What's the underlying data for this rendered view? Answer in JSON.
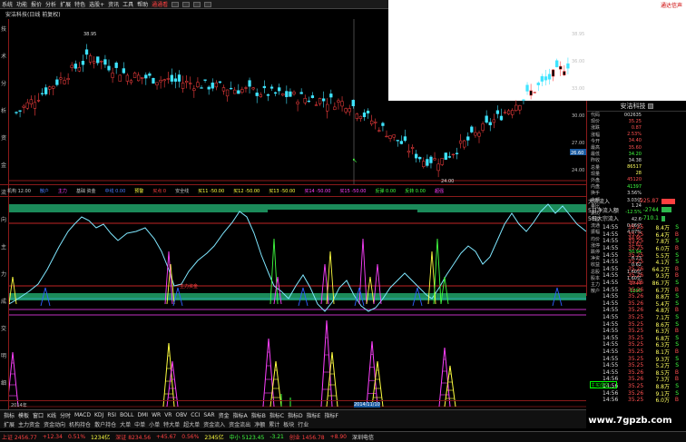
{
  "menu": {
    "items": [
      "系统",
      "功能",
      "报价",
      "分析",
      "扩展",
      "特色",
      "选股+",
      "资讯",
      "工具",
      "帮助"
    ],
    "highlight": "通通看",
    "notice": "通达信声"
  },
  "window_title": "安洁科技(日线 前复权)",
  "left_axis_labels": [
    "技",
    "术",
    "分",
    "析",
    "资",
    "金",
    "流",
    "向",
    "主",
    "力",
    "成",
    "交",
    "明",
    "细"
  ],
  "price_axis": {
    "labels": [
      "38.95",
      "36.00",
      "33.00",
      "30.00",
      "27.00",
      "24.00"
    ],
    "marks": {
      "high": "38.95",
      "low": "24.00",
      "current": "26.60"
    }
  },
  "indicator_bar": {
    "items": [
      {
        "text": "机构 12.00",
        "color": "#cccccc"
      },
      {
        "text": "散户",
        "color": "#4c7cff"
      },
      {
        "text": "主力",
        "color": "#ff40ff"
      },
      {
        "text": "基础 资金",
        "color": "#cccccc"
      },
      {
        "text": "中线 0.00",
        "color": "#4c7cff"
      },
      {
        "text": "预警",
        "color": "#ffff40"
      },
      {
        "text": "买点 0",
        "color": "#ff4040"
      },
      {
        "text": "安全线",
        "color": "#cccccc"
      },
      {
        "text": "买11 -50.00",
        "color": "#ffff40"
      },
      {
        "text": "买12 -50.00",
        "color": "#ffff40"
      },
      {
        "text": "买13 -50.00",
        "color": "#ffff40"
      },
      {
        "text": "买14 -50.00",
        "color": "#ff40ff"
      },
      {
        "text": "买15 -50.00",
        "color": "#ff40ff"
      },
      {
        "text": "反弹 0.00",
        "color": "#40ff40"
      },
      {
        "text": "反转 0.00",
        "color": "#40ff40"
      },
      {
        "text": "超强",
        "color": "#ff40ff"
      }
    ]
  },
  "osc_labels": {
    "mid": "主力资金"
  },
  "date_bar": {
    "labels": [
      "2014年",
      "2014/11/10"
    ]
  },
  "bottom_tabs": [
    "指标",
    "模板",
    "窗口",
    "K线",
    "分时",
    "MACD",
    "KDJ",
    "RSI",
    "BOLL",
    "DMI",
    "WR",
    "VR",
    "OBV",
    "CCI",
    "SAR",
    "资金",
    "指标A",
    "指标B",
    "指标C",
    "指标D",
    "指标E",
    "指标F"
  ],
  "second_tabs": [
    "扩展",
    "主力资金",
    "资金动向",
    "机构持仓",
    "散户持仓",
    "大单",
    "中单",
    "小单",
    "特大单",
    "超大单",
    "资金流入",
    "资金流出",
    "净额",
    "累计",
    "板块",
    "行业"
  ],
  "status_bar": {
    "items": [
      {
        "text": "上证 2456.77",
        "color": "#ff4040"
      },
      {
        "text": "+12.34",
        "color": "#ff4040"
      },
      {
        "text": "0.51%",
        "color": "#ff4040"
      },
      {
        "text": "1234亿",
        "color": "#ffff40"
      },
      {
        "text": "深证 8234.56",
        "color": "#ff4040"
      },
      {
        "text": "+45.67",
        "color": "#ff4040"
      },
      {
        "text": "0.56%",
        "color": "#ff4040"
      },
      {
        "text": "2345亿",
        "color": "#ffff40"
      },
      {
        "text": "中小 5123.45",
        "color": "#40ff40"
      },
      {
        "text": "-3.21",
        "color": "#40ff40"
      },
      {
        "text": "创业 1456.78",
        "color": "#ff4040"
      },
      {
        "text": "+8.90",
        "color": "#ff4040"
      },
      {
        "text": "深圳电信",
        "color": "#dddddd"
      }
    ]
  },
  "quote_panel": {
    "title": "安洁科技",
    "rows": [
      {
        "k": "代码",
        "v": "002635",
        "color": "#dddddd"
      },
      {
        "k": "现价",
        "v": "35.25",
        "color": "#ff5050"
      },
      {
        "k": "涨跌",
        "v": "0.87",
        "color": "#ff5050"
      },
      {
        "k": "涨幅",
        "v": "2.53%",
        "color": "#ff5050"
      },
      {
        "k": "今开",
        "v": "34.40",
        "color": "#ff5050"
      },
      {
        "k": "最高",
        "v": "35.60",
        "color": "#ff5050"
      },
      {
        "k": "最低",
        "v": "34.20",
        "color": "#40ff40"
      },
      {
        "k": "昨收",
        "v": "34.38",
        "color": "#dddddd"
      },
      {
        "k": "总量",
        "v": "86517",
        "color": "#ffff60"
      },
      {
        "k": "现量",
        "v": "28",
        "color": "#ffff60"
      },
      {
        "k": "外盘",
        "v": "45120",
        "color": "#ff5050"
      },
      {
        "k": "内盘",
        "v": "41397",
        "color": "#40ff40"
      },
      {
        "k": "换手",
        "v": "3.56%",
        "color": "#dddddd"
      },
      {
        "k": "金额",
        "v": "3.03亿",
        "color": "#dddddd"
      },
      {
        "k": "量比",
        "v": "1.24",
        "color": "#dddddd"
      },
      {
        "k": "委比",
        "v": "-12.5%",
        "color": "#40ff40"
      },
      {
        "k": "市盈",
        "v": "42.6",
        "color": "#dddddd"
      },
      {
        "k": "流通",
        "v": "0.86亿",
        "color": "#dddddd"
      },
      {
        "k": "振幅",
        "v": "4.07%",
        "color": "#dddddd"
      },
      {
        "k": "均价",
        "v": "34.95",
        "color": "#ff5050"
      },
      {
        "k": "涨停",
        "v": "37.82",
        "color": "#ff5050"
      },
      {
        "k": "跌停",
        "v": "30.94",
        "color": "#40ff40"
      },
      {
        "k": "净资",
        "v": "8.23",
        "color": "#dddddd"
      },
      {
        "k": "收益",
        "v": "0.62",
        "color": "#dddddd"
      },
      {
        "k": "总股",
        "v": "1.60亿",
        "color": "#dddddd"
      },
      {
        "k": "股本",
        "v": "1.60亿",
        "color": "#dddddd"
      },
      {
        "k": "主力",
        "v": "2744",
        "color": "#ff5050"
      },
      {
        "k": "散户",
        "v": "-1200",
        "color": "#40ff40"
      }
    ]
  },
  "flow_panel": {
    "rows": [
      {
        "k": "大宗流入",
        "v": "925.87",
        "color": "#ff5050",
        "bar": 0.62,
        "barColor": "#ff4040"
      },
      {
        "k": "5日净流入额",
        "v": "-2744",
        "color": "#40ff40",
        "bar": 0.45,
        "barColor": "#2db84d"
      },
      {
        "k": "5日大宗流入",
        "v": "-710.1",
        "color": "#40ff40",
        "bar": 0.18,
        "barColor": "#2db84d"
      }
    ]
  },
  "ticks": {
    "rows": [
      {
        "t": "14:55",
        "p": "35.25",
        "vol": "8.4万",
        "bs": "S",
        "bsColor": "#40ff40"
      },
      {
        "t": "14:55",
        "p": "35.25",
        "vol": "6.4万",
        "bs": "B",
        "bsColor": "#ff5050"
      },
      {
        "t": "14:55",
        "p": "35.25",
        "vol": "7.8万",
        "bs": "S",
        "bsColor": "#40ff40"
      },
      {
        "t": "14:55",
        "p": "35.25",
        "vol": "6.0万",
        "bs": "B",
        "bsColor": "#ff5050"
      },
      {
        "t": "14:55",
        "p": "35.25",
        "vol": "5.5万",
        "bs": "S",
        "bsColor": "#40ff40"
      },
      {
        "t": "14:55",
        "p": "35.25",
        "vol": "4.1万",
        "bs": "S",
        "bsColor": "#40ff40"
      },
      {
        "t": "14:55",
        "p": "35.26",
        "vol": "64.2万",
        "bs": "B",
        "bsColor": "#ff5050"
      },
      {
        "t": "14:55",
        "p": "35.26",
        "vol": "9.3万",
        "bs": "B",
        "bsColor": "#ff5050"
      },
      {
        "t": "14:55",
        "p": "35.26",
        "vol": "86.7万",
        "bs": "S",
        "bsColor": "#40ff40"
      },
      {
        "t": "14:55",
        "p": "35.26",
        "vol": "6.7万",
        "bs": "B",
        "bsColor": "#ff5050"
      },
      {
        "t": "14:55",
        "p": "35.26",
        "vol": "8.8万",
        "bs": "S",
        "bsColor": "#40ff40"
      },
      {
        "t": "14:55",
        "p": "35.26",
        "vol": "5.4万",
        "bs": "S",
        "bsColor": "#40ff40"
      },
      {
        "t": "14:55",
        "p": "35.26",
        "vol": "4.8万",
        "bs": "B",
        "bsColor": "#ff5050"
      },
      {
        "t": "14:55",
        "p": "35.25",
        "vol": "7.1万",
        "bs": "S",
        "bsColor": "#40ff40"
      },
      {
        "t": "14:55",
        "p": "35.25",
        "vol": "8.6万",
        "bs": "S",
        "bsColor": "#40ff40"
      },
      {
        "t": "14:55",
        "p": "35.25",
        "vol": "6.3万",
        "bs": "B",
        "bsColor": "#ff5050"
      },
      {
        "t": "14:55",
        "p": "35.25",
        "vol": "6.8万",
        "bs": "S",
        "bsColor": "#40ff40"
      },
      {
        "t": "14:55",
        "p": "35.25",
        "vol": "6.3万",
        "bs": "S",
        "bsColor": "#40ff40"
      },
      {
        "t": "14:55",
        "p": "35.25",
        "vol": "8.1万",
        "bs": "B",
        "bsColor": "#ff5050"
      },
      {
        "t": "14:55",
        "p": "35.25",
        "vol": "9.3万",
        "bs": "S",
        "bsColor": "#40ff40"
      },
      {
        "t": "14:55",
        "p": "35.25",
        "vol": "5.2万",
        "bs": "S",
        "bsColor": "#40ff40"
      },
      {
        "t": "14:55",
        "p": "35.26",
        "vol": "8.5万",
        "bs": "B",
        "bsColor": "#ff5050"
      },
      {
        "t": "14:56",
        "p": "35.26",
        "vol": "7.3万",
        "bs": "B",
        "bsColor": "#ff5050"
      },
      {
        "t": "14:56",
        "p": "35.25",
        "vol": "8.8万",
        "bs": "S",
        "bsColor": "#40ff40"
      },
      {
        "t": "14:56",
        "p": "35.26",
        "vol": "9.1万",
        "bs": "S",
        "bsColor": "#40ff40"
      },
      {
        "t": "14:56",
        "p": "35.25",
        "vol": "6.0万",
        "bs": "B",
        "bsColor": "#ff5050"
      }
    ]
  },
  "watermark": "www.7gpzb.com",
  "tiny_button": "主买成交"
}
